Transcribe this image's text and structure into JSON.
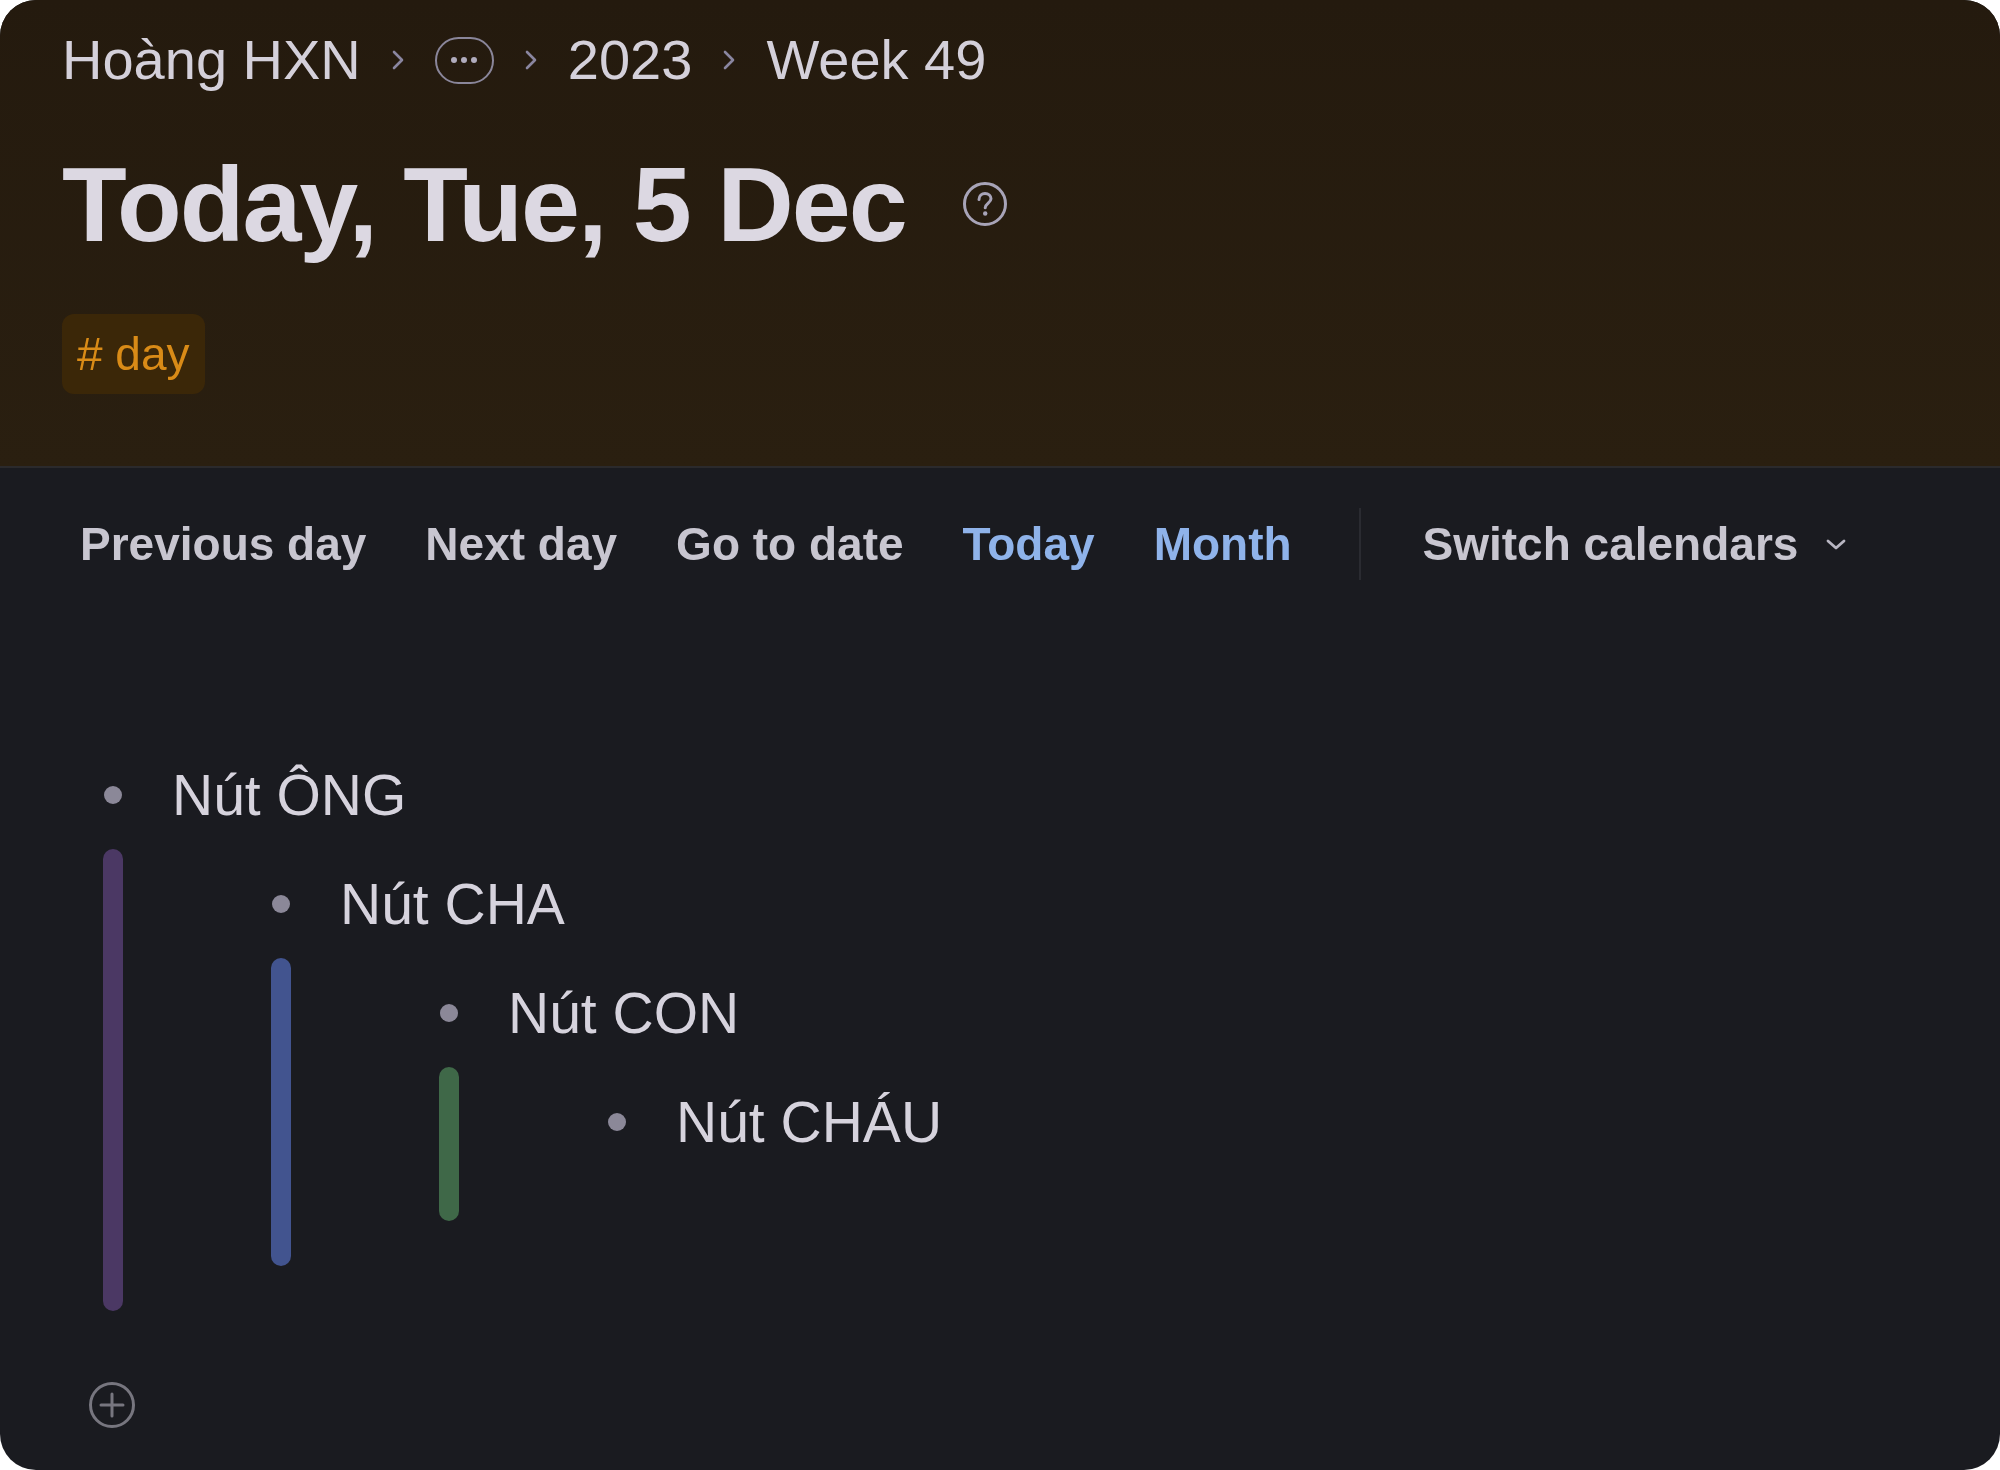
{
  "breadcrumb": [
    {
      "kind": "crumb",
      "label": "Hoàng HXN"
    },
    {
      "kind": "collapsed"
    },
    {
      "kind": "crumb",
      "label": "2023"
    },
    {
      "kind": "crumb",
      "label": "Week 49"
    }
  ],
  "page": {
    "title": "Today, Tue, 5 Dec",
    "tag": {
      "label": "# day"
    }
  },
  "toolbar": {
    "actions": [
      {
        "label": "Previous day",
        "highlighted": false
      },
      {
        "label": "Next day",
        "highlighted": false
      },
      {
        "label": "Go to date",
        "highlighted": false
      },
      {
        "label": "Today",
        "highlighted": true
      },
      {
        "label": "Month",
        "highlighted": true
      }
    ],
    "dropdown": {
      "label": "Switch calendars"
    }
  },
  "outline": [
    {
      "text": "Nút ÔNG",
      "color": "#4b3864",
      "children": [
        {
          "text": "Nút CHA",
          "color": "#42548f",
          "children": [
            {
              "text": "Nút CON",
              "color": "#3f6848",
              "children": [
                {
                  "text": "Nút CHÁU"
                }
              ]
            }
          ]
        }
      ]
    }
  ]
}
